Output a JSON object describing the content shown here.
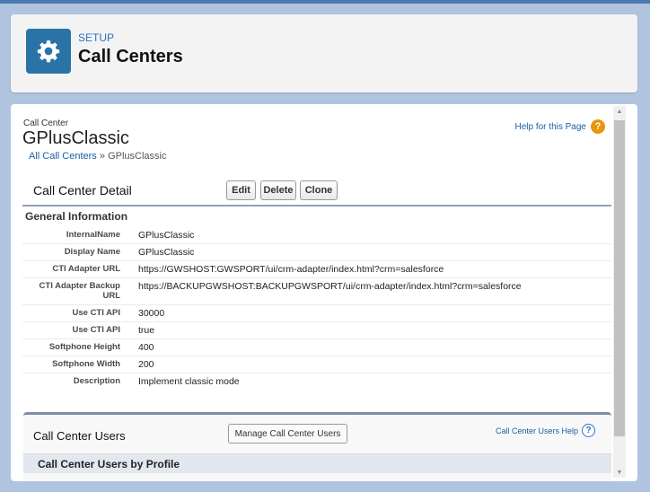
{
  "header": {
    "section": "SETUP",
    "title": "Call Centers",
    "icon": "gear-icon"
  },
  "record": {
    "type_label": "Call Center",
    "name": "GPlusClassic",
    "breadcrumb": {
      "link": "All Call Centers",
      "separator": "»",
      "current": "GPlusClassic"
    },
    "help_link": "Help for this Page"
  },
  "detail": {
    "title": "Call Center Detail",
    "buttons": {
      "edit": "Edit",
      "delete": "Delete",
      "clone": "Clone"
    },
    "section": "General Information",
    "fields": [
      {
        "label": "InternalName",
        "value": "GPlusClassic"
      },
      {
        "label": "Display Name",
        "value": "GPlusClassic"
      },
      {
        "label": "CTI Adapter URL",
        "value": "https://GWSHOST:GWSPORT/ui/crm-adapter/index.html?crm=salesforce"
      },
      {
        "label": "CTI Adapter Backup URL",
        "value": "https://BACKUPGWSHOST:BACKUPGWSPORT/ui/crm-adapter/index.html?crm=salesforce"
      },
      {
        "label": "Use CTI API",
        "value": "30000"
      },
      {
        "label": "Use CTI API",
        "value": "true"
      },
      {
        "label": "Softphone Height",
        "value": "400"
      },
      {
        "label": "Softphone Width",
        "value": "200"
      },
      {
        "label": "Description",
        "value": "Implement classic mode"
      }
    ]
  },
  "users": {
    "title": "Call Center Users",
    "manage_button": "Manage Call Center Users",
    "help_link": "Call Center Users Help",
    "by_profile": "Call Center Users by Profile"
  }
}
